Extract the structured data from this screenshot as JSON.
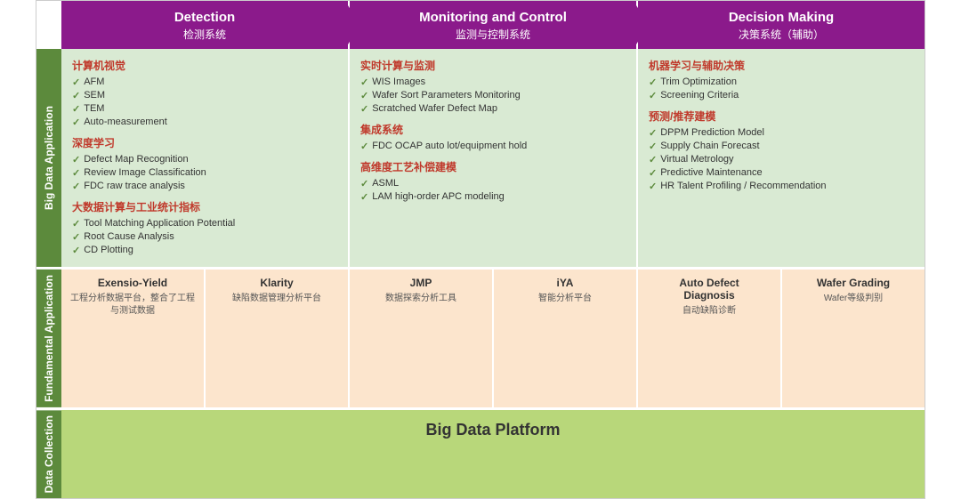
{
  "header": {
    "col1": {
      "en": "Detection",
      "cn": "检测系统"
    },
    "col2": {
      "en": "Monitoring and Control",
      "cn": "监测与控制系统"
    },
    "col3": {
      "en": "Decision Making",
      "cn": "决策系统（辅助）"
    }
  },
  "rowLabels": {
    "bigData": "Big Data Application",
    "fundamental": "Fundamental\nApplication",
    "dataCollection": "Data\nCollection"
  },
  "bigData": {
    "col1": {
      "sections": [
        {
          "title": "计算机视觉",
          "items": [
            "AFM",
            "SEM",
            "TEM",
            "Auto-measurement"
          ]
        },
        {
          "title": "深度学习",
          "items": [
            "Defect Map Recognition",
            "Review Image Classification",
            "FDC raw trace analysis"
          ]
        },
        {
          "title": "大数据计算与工业统计指标",
          "items": [
            "Tool Matching Application Potential",
            "Root Cause Analysis",
            "CD Plotting"
          ]
        }
      ]
    },
    "col2": {
      "sections": [
        {
          "title": "实时计算与监测",
          "items": [
            "WIS Images",
            "Wafer Sort Parameters Monitoring",
            "Scratched Wafer Defect Map"
          ]
        },
        {
          "title": "集成系统",
          "items": [
            "FDC OCAP auto lot/equipment hold"
          ]
        },
        {
          "title": "高维度工艺补偿建模",
          "items": [
            "ASML",
            "LAM high-order APC modeling"
          ]
        }
      ]
    },
    "col3": {
      "sections": [
        {
          "title": "机器学习与辅助决策",
          "items": [
            "Trim Optimization",
            "Screening Criteria"
          ]
        },
        {
          "title": "预测/推荐建模",
          "items": [
            "DPPM Prediction Model",
            "Supply Chain Forecast",
            "Virtual Metrology",
            "Predictive Maintenance",
            "HR Talent Profiling / Recommendation"
          ]
        }
      ]
    }
  },
  "fundamental": {
    "cells": [
      {
        "name": "Exensio-Yield",
        "desc": "工程分析数据平台，整合了工程与测试数据"
      },
      {
        "name": "Klarity",
        "desc": "缺陷数据管理分析平台"
      },
      {
        "name": "JMP",
        "desc": "数据探索分析工具"
      },
      {
        "name": "iYA",
        "desc": "智能分析平台"
      },
      {
        "name": "Auto Defect\nDiagnosis",
        "desc": "自动缺陷诊断"
      },
      {
        "name": "Wafer  Grading",
        "desc": "Wafer等级判别"
      }
    ]
  },
  "dataCollection": {
    "platform": "Big Data Platform"
  }
}
